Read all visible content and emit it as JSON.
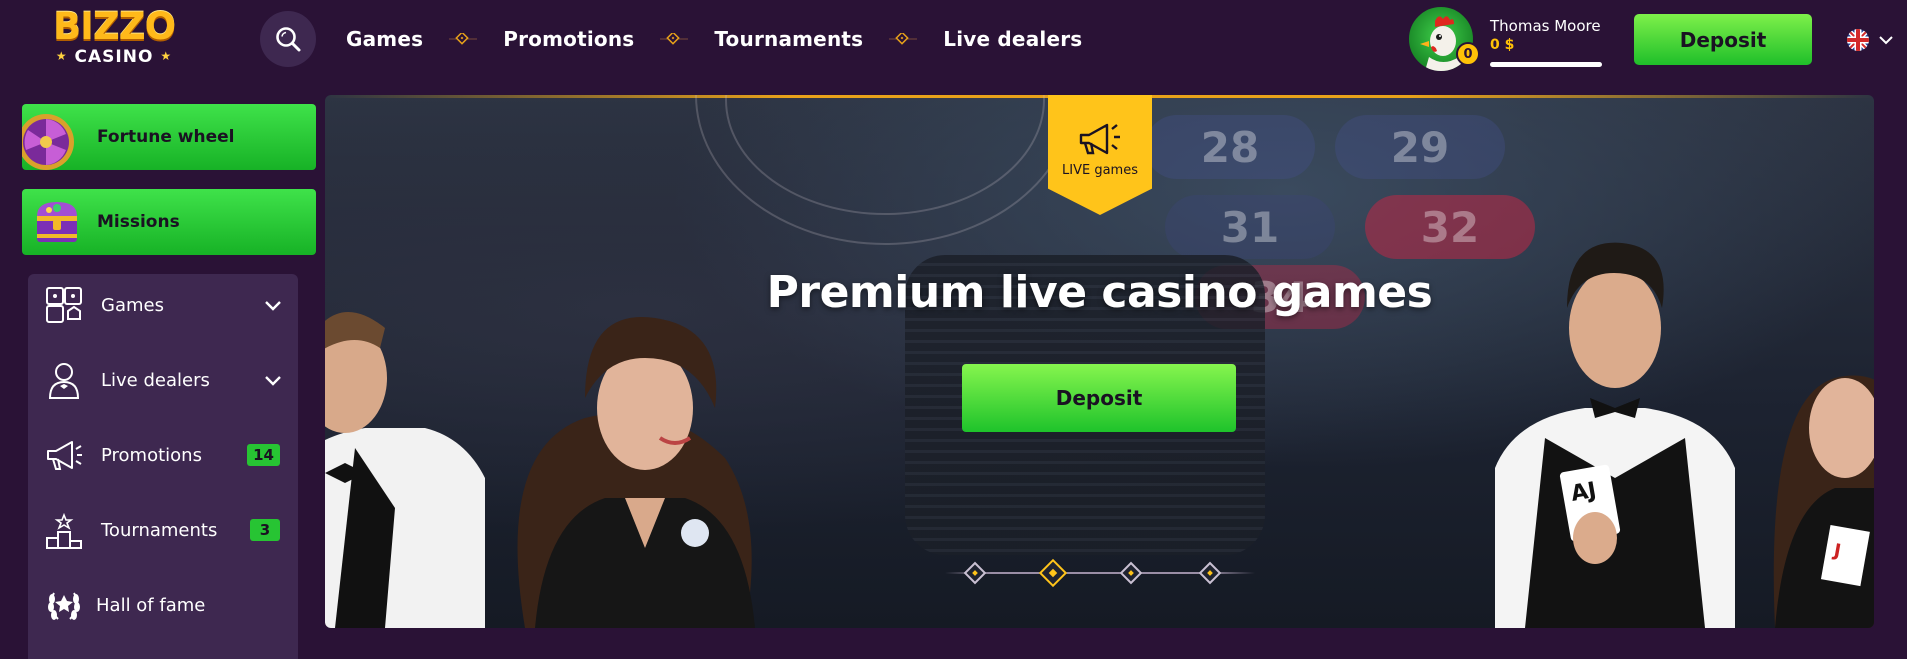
{
  "header": {
    "logo_top": "BIZZO",
    "logo_bottom": "CASINO",
    "nav": [
      "Games",
      "Promotions",
      "Tournaments",
      "Live dealers"
    ],
    "user": {
      "name": "Thomas Moore",
      "balance": "0 $",
      "coins": "0",
      "avatar": "rooster-avatar"
    },
    "deposit_label": "Deposit",
    "language": "en-gb-flag"
  },
  "sidebar": {
    "promo_buttons": [
      {
        "label": "Fortune wheel",
        "icon": "fortune-wheel-icon"
      },
      {
        "label": "Missions",
        "icon": "treasure-chest-icon"
      }
    ],
    "items": [
      {
        "label": "Games",
        "icon": "games-icon",
        "expandable": true
      },
      {
        "label": "Live dealers",
        "icon": "dealer-icon",
        "expandable": true
      },
      {
        "label": "Promotions",
        "icon": "megaphone-icon",
        "badge": "14"
      },
      {
        "label": "Tournaments",
        "icon": "podium-icon",
        "badge": "3"
      },
      {
        "label": "Hall of fame",
        "icon": "laurel-icon"
      }
    ]
  },
  "banner": {
    "tag": "LIVE games",
    "title": "Premium live casino games",
    "deposit_label": "Deposit",
    "slides": 4,
    "active_slide": 2,
    "table_numbers": [
      "28",
      "29",
      "31",
      "32",
      "34"
    ]
  },
  "colors": {
    "background": "#2a1236",
    "panel": "#3e2850",
    "accent_green": "#1fbf2a",
    "accent_gold": "#ffc41a"
  }
}
